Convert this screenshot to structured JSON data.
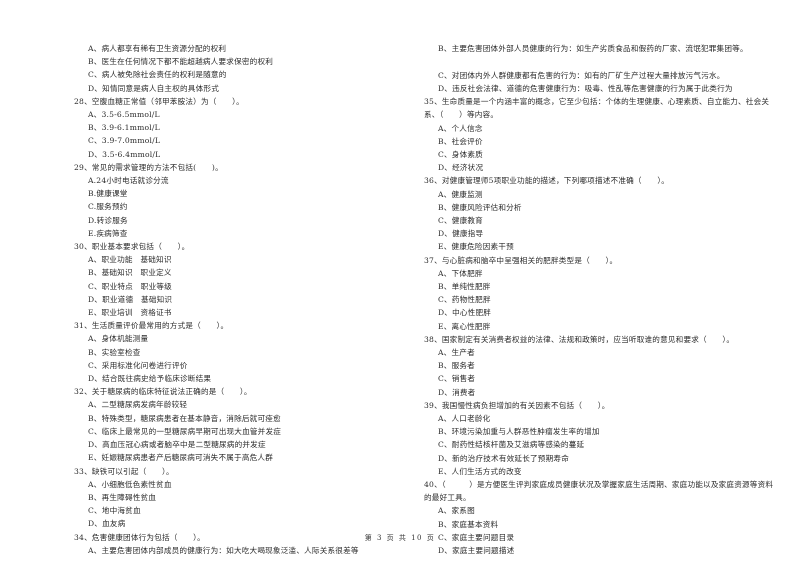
{
  "left_column": {
    "q27_options": [
      "A、病人都享有稀有卫生资源分配的权利",
      "B、医生在任何情况下都不能超越病人要求保密的权利",
      "C、病人被免除社会责任的权利是随意的",
      "D、知情同意是病人自主权的具体形式"
    ],
    "q28": {
      "stem": "28、空腹血糖正常值（邻甲苯胺法）为（　　）。",
      "options": [
        "A、3.5-6.5mmol/L",
        "B、3.9-6.1mmol/L",
        "C、3.9-7.0mmol/L",
        "D、3.5-6.4mmol/L"
      ]
    },
    "q29": {
      "stem": "29、常见的需求管理的方法不包括(　　)。",
      "options": [
        "A.24小时电话就诊分流",
        "B.健康课堂",
        "C.服务预约",
        "D.转诊服务",
        "E.疾病筛查"
      ]
    },
    "q30": {
      "stem": "30、职业基本要求包括（　　）。",
      "options": [
        "A、职业功能　基础知识",
        "B、基础知识　职业定义",
        "C、职业特点　职业等级",
        "D、职业道德　基础知识",
        "E、职业培训　资格证书"
      ]
    },
    "q31": {
      "stem": "31、生活质量评价最常用的方式是（　　）。",
      "options": [
        "A、身体机能测量",
        "B、实验室检查",
        "C、采用标准化问卷进行评价",
        "D、结合既往病史给予临床诊断结果"
      ]
    },
    "q32": {
      "stem": "32、关于糖尿病的临床特征说法正确的是（　　）。",
      "options": [
        "A、二型糖尿病发病年龄较轻",
        "B、特殊类型，糖尿病患者在基本静音，消除后就可痊愈",
        "C、临床上最常见的一型糖尿病早期可出现大血管并发症",
        "D、高血压冠心病或者脑卒中是二型糖尿病的并发症",
        "E、妊娠糖尿病患者产后糖尿病可消失不属于高危人群"
      ]
    },
    "q33": {
      "stem": "33、缺铁可以引起（　　）。",
      "options": [
        "A、小细胞低色素性贫血",
        "B、再生障碍性贫血",
        "C、地中海贫血",
        "D、血友病"
      ]
    },
    "q34": {
      "stem": "34、危害健康团体行为包括（　　）。",
      "options": [
        "A、主要危害团体内部成员的健康行为：如大吃大喝现象泛滥、人际关系很差等"
      ]
    }
  },
  "right_column": {
    "q34_cont": [
      "B、主要危害团体外部人员健康的行为：如生产劣质食品和假药的厂家、流氓犯罪集团等。",
      "C、对团体内外人群健康都有危害的行为：如有的厂矿生产过程大量排放污气污水。",
      "D、违反社会法律、道德的危害健康行为：吸毒、性乱等危害健康的行为属于此类行为"
    ],
    "q35": {
      "stem": "35、生命质量是一个内涵丰富的概念，它至少包括：个体的生理健康、心理素质、自立能力、社会关系、（　　）等内容。",
      "options": [
        "A、个人信念",
        "B、社会评价",
        "C、身体素质",
        "D、经济状况"
      ]
    },
    "q36": {
      "stem": "36、对健康管理师5项职业功能的描述，下列哪项描述不准确（　　）。",
      "options": [
        "A、健康监测",
        "B、健康风险评估和分析",
        "C、健康教育",
        "D、健康指导",
        "E、健康危险因素干预"
      ]
    },
    "q37": {
      "stem": "37、与心脏病和脑卒中呈强相关的肥胖类型是（　　）。",
      "options": [
        "A、下体肥胖",
        "B、单纯性肥胖",
        "C、药物性肥胖",
        "D、中心性肥胖",
        "E、离心性肥胖"
      ]
    },
    "q38": {
      "stem": "38、国家制定有关消费者权益的法律、法规和政策时，应当听取谁的意见和要求（　　）。",
      "options": [
        "A、生产者",
        "B、服务者",
        "C、销售者",
        "D、消费者"
      ]
    },
    "q39": {
      "stem": "39、我国慢性病负担增加的有关因素不包括（　　）。",
      "options": [
        "A、人口老龄化",
        "B、环境污染加重与人群恶性肿瘤发生率的增加",
        "C、耐药性结核杆菌及艾滋病等感染的蔓延",
        "D、新的治疗技术有效延长了预期寿命",
        "E、人们生活方式的改变"
      ]
    },
    "q40": {
      "stem": "40、（　　　）是方便医生评判家庭成员健康状况及掌握家庭生活周期、家庭功能以及家庭资源等资料的最好工具。",
      "options": [
        "A、家系图",
        "B、家庭基本资料",
        "C、家庭主要问题目录",
        "D、家庭主要问题描述"
      ]
    }
  },
  "footer": {
    "page_label": "第 3 页 共 10 页"
  }
}
